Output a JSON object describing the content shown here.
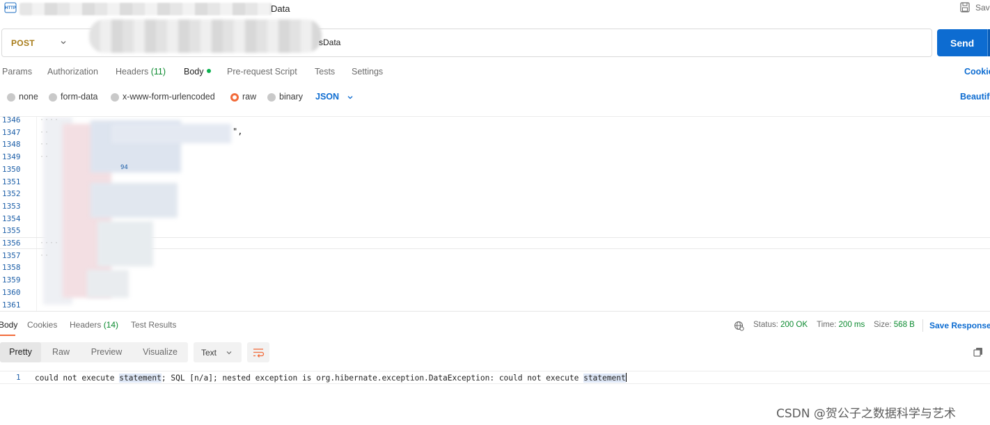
{
  "header": {
    "title_suffix": "Data",
    "save_label": "Sav"
  },
  "request": {
    "method": "POST",
    "url_suffix": "sData",
    "send_label": "Send",
    "tabs": [
      {
        "label": "Params"
      },
      {
        "label": "Authorization"
      },
      {
        "label": "Headers",
        "count": "(11)"
      },
      {
        "label": "Body"
      },
      {
        "label": "Pre-request Script"
      },
      {
        "label": "Tests"
      },
      {
        "label": "Settings"
      }
    ],
    "cookies_label": "Cookie",
    "body_modes": [
      {
        "label": "none",
        "selected": false
      },
      {
        "label": "form-data",
        "selected": false
      },
      {
        "label": "x-www-form-urlencoded",
        "selected": false
      },
      {
        "label": "raw",
        "selected": true
      },
      {
        "label": "binary",
        "selected": false
      }
    ],
    "raw_format": "JSON",
    "beautify_label": "Beautify"
  },
  "editor": {
    "line_numbers": [
      "1346",
      "1347",
      "1348",
      "1349",
      "1350",
      "1351",
      "1352",
      "1353",
      "1354",
      "1355",
      "1356",
      "1357",
      "1358",
      "1359",
      "1360",
      "1361"
    ],
    "visible_fragment": "\",",
    "blue_fragment": "94"
  },
  "response": {
    "tabs": [
      {
        "label": "Body"
      },
      {
        "label": "Cookies"
      },
      {
        "label": "Headers",
        "count": "(14)"
      },
      {
        "label": "Test Results"
      }
    ],
    "status_label": "Status:",
    "status_value": "200 OK",
    "time_label": "Time:",
    "time_value": "200 ms",
    "size_label": "Size:",
    "size_value": "568 B",
    "save_response_label": "Save Response",
    "view_modes": [
      "Pretty",
      "Raw",
      "Preview",
      "Visualize"
    ],
    "active_view": "Pretty",
    "text_format": "Text",
    "line_number": "1",
    "body_parts": [
      "could not execute ",
      "statement",
      "; SQL [n/a]; nested exception is org.hibernate.exception.DataException: could not execute ",
      "statement"
    ]
  },
  "watermark": "CSDN @贺公子之数据科学与艺术",
  "colors": {
    "accent": "#0d6cd1",
    "method": "#a87c19",
    "success": "#0b8a2f",
    "active_tab": "#f26b3a"
  }
}
